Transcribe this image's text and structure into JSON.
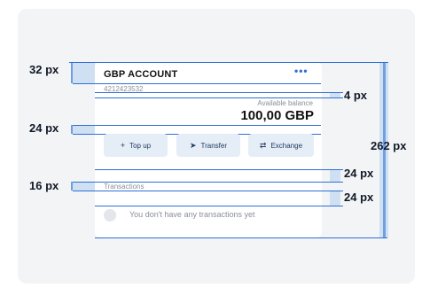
{
  "account": {
    "title": "GBP ACCOUNT",
    "menu_icon": "more-horizontal-icon",
    "number": "4212423532",
    "balance_label": "Available balance",
    "balance_value": "100,00 GBP"
  },
  "actions": [
    {
      "label": "Top up",
      "icon": "plus-icon",
      "icon_glyph": "+"
    },
    {
      "label": "Transfer",
      "icon": "send-icon",
      "icon_glyph": "➤"
    },
    {
      "label": "Exchange",
      "icon": "exchange-icon",
      "icon_glyph": "⇄"
    }
  ],
  "transactions": {
    "label": "Transactions",
    "empty_text": "You don't have any transactions yet"
  },
  "spacing_annotations": {
    "top_padding": "32 px",
    "number_gap": "4 px",
    "balance_gap": "24 px",
    "total_height": "262 px",
    "actions_gap": "24 px",
    "transactions_padding": "16 px",
    "list_gap": "24 px"
  },
  "colors": {
    "accent": "#2f6fd6",
    "band": "#cfe0f3",
    "button_bg": "#e5edf6",
    "backdrop": "#f2f4f6"
  }
}
